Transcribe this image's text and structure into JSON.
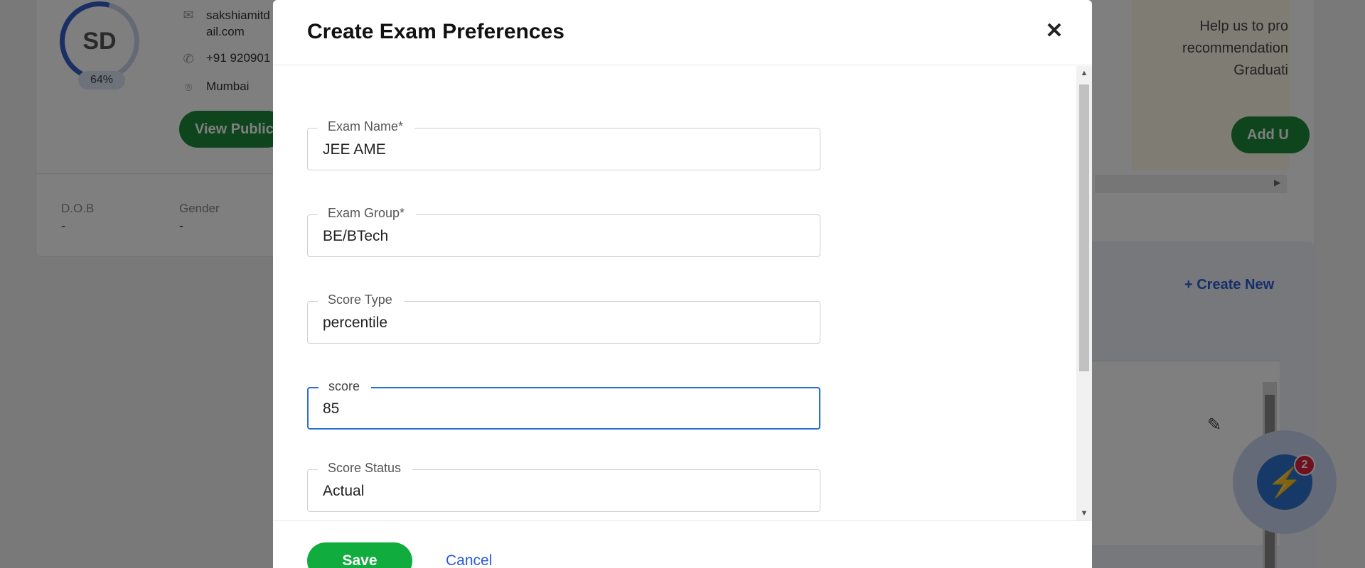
{
  "background": {
    "avatar_initials": "SD",
    "profile_completion": "64%",
    "email_line1": "sakshiamitd",
    "email_line2": "ail.com",
    "phone": "+91 920901",
    "location": "Mumbai",
    "view_public_label": "View Public",
    "dob_label": "D.O.B",
    "dob_value": "-",
    "gender_label": "Gender",
    "gender_value": "-",
    "promo_line1": "Help us to pro",
    "promo_line2": "recommendation",
    "promo_line3": "Graduati",
    "add_label": "Add U",
    "create_new_label": "+ Create New",
    "notification_count": "2"
  },
  "modal": {
    "title": "Create Exam Preferences",
    "fields": [
      {
        "label": "Exam Name*",
        "value": "JEE AME"
      },
      {
        "label": "Exam Group*",
        "value": "BE/BTech"
      },
      {
        "label": "Score Type",
        "value": "percentile"
      },
      {
        "label": "score",
        "value": "85"
      },
      {
        "label": "Score Status",
        "value": "Actual"
      }
    ],
    "save_label": "Save",
    "cancel_label": "Cancel"
  },
  "colors": {
    "primary_green": "#10ad3e",
    "focus_blue": "#2a6fd6",
    "link_blue": "#2a5bd7"
  }
}
